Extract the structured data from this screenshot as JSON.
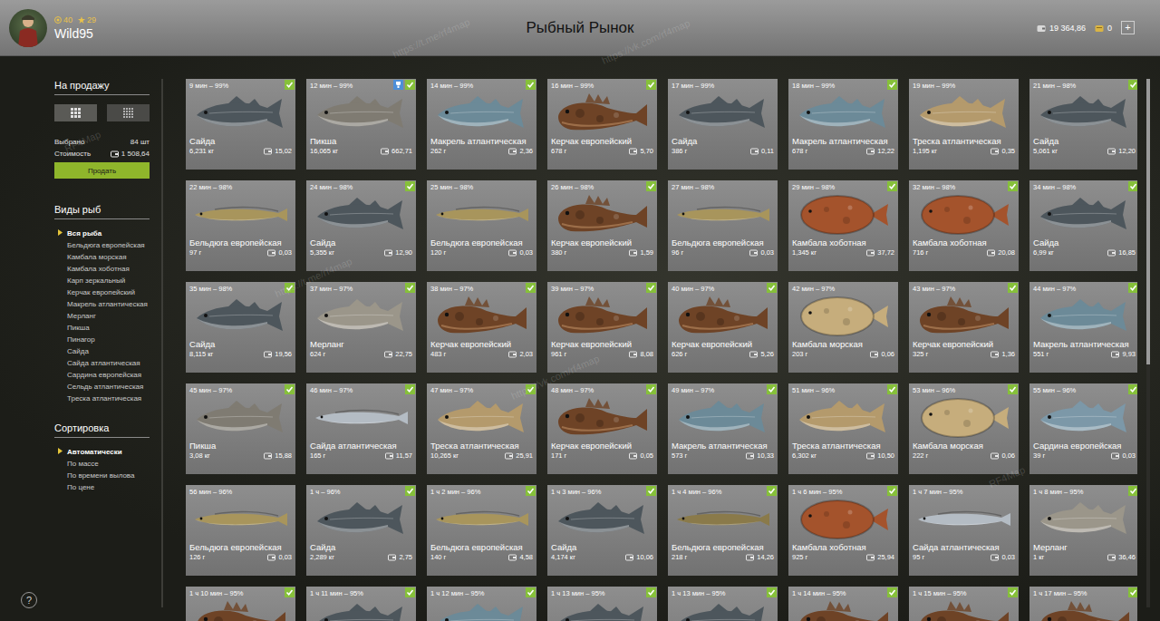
{
  "header": {
    "title": "Рыбный Рынок",
    "player": {
      "name": "Wild95",
      "level": "40",
      "stars": "29"
    },
    "money": "19 364,86",
    "gold": "0",
    "add": "+"
  },
  "sidebar": {
    "for_sale": "На продажу",
    "views": [
      {
        "selected": true
      },
      {
        "selected": false
      }
    ],
    "selected_label": "Выбрано",
    "selected_value": "84 шт",
    "cost_label": "Стоимость",
    "cost_value": "1 508,64",
    "sell": "Продать",
    "species_title": "Виды рыб",
    "species": [
      {
        "label": "Вся рыба",
        "selected": true
      },
      {
        "label": "Бельдюга европейская",
        "selected": false
      },
      {
        "label": "Камбала морская",
        "selected": false
      },
      {
        "label": "Камбала хоботная",
        "selected": false
      },
      {
        "label": "Карп зеркальный",
        "selected": false
      },
      {
        "label": "Керчак европейский",
        "selected": false
      },
      {
        "label": "Макрель атлантическая",
        "selected": false
      },
      {
        "label": "Мерланг",
        "selected": false
      },
      {
        "label": "Пикша",
        "selected": false
      },
      {
        "label": "Пинагор",
        "selected": false
      },
      {
        "label": "Сайда",
        "selected": false
      },
      {
        "label": "Сайда атлантическая",
        "selected": false
      },
      {
        "label": "Сардина европейская",
        "selected": false
      },
      {
        "label": "Сельдь атлантическая",
        "selected": false
      },
      {
        "label": "Треска атлантическая",
        "selected": false
      }
    ],
    "sort_title": "Сортировка",
    "sort": [
      {
        "label": "Автоматически",
        "selected": true
      },
      {
        "label": "По массе",
        "selected": false
      },
      {
        "label": "По времени вылова",
        "selected": false
      },
      {
        "label": "По цене",
        "selected": false
      }
    ]
  },
  "help": "?",
  "scrollbar": {
    "level": 0.54
  },
  "cards": [
    {
      "time": "9 мин – 99%",
      "name": "Сайда",
      "weight": "6,231 кг",
      "price": "15,02",
      "selected": true,
      "badge": false,
      "kind": "round",
      "color": "#4d565c"
    },
    {
      "time": "12 мин – 99%",
      "name": "Пикша",
      "weight": "16,065 кг",
      "price": "662,71",
      "selected": true,
      "badge": true,
      "kind": "round",
      "color": "#7f7b72"
    },
    {
      "time": "14 мин – 99%",
      "name": "Макрель атлантическая",
      "weight": "262 г",
      "price": "2,36",
      "selected": true,
      "badge": false,
      "kind": "round",
      "color": "#6c8a98"
    },
    {
      "time": "16 мин – 99%",
      "name": "Керчак европейский",
      "weight": "678 г",
      "price": "5,70",
      "selected": true,
      "badge": false,
      "kind": "spiny",
      "color": "#6e4326"
    },
    {
      "time": "17 мин – 99%",
      "name": "Сайда",
      "weight": "386 г",
      "price": "0,11",
      "selected": false,
      "badge": false,
      "kind": "round",
      "color": "#4d565c"
    },
    {
      "time": "18 мин – 99%",
      "name": "Макрель атлантическая",
      "weight": "678 г",
      "price": "12,22",
      "selected": true,
      "badge": false,
      "kind": "round",
      "color": "#6c8a98"
    },
    {
      "time": "19 мин – 99%",
      "name": "Треска атлантическая",
      "weight": "1,195 кг",
      "price": "0,35",
      "selected": false,
      "badge": false,
      "kind": "round",
      "color": "#b49a6c"
    },
    {
      "time": "21 мин – 98%",
      "name": "Сайда",
      "weight": "5,061 кг",
      "price": "12,20",
      "selected": true,
      "badge": false,
      "kind": "round",
      "color": "#4d565c"
    },
    {
      "time": "22 мин – 98%",
      "name": "Бельдюга европейская",
      "weight": "97 г",
      "price": "0,03",
      "selected": false,
      "badge": false,
      "kind": "long",
      "color": "#a8955c"
    },
    {
      "time": "24 мин – 98%",
      "name": "Сайда",
      "weight": "5,355 кг",
      "price": "12,90",
      "selected": true,
      "badge": false,
      "kind": "round",
      "color": "#4d565c"
    },
    {
      "time": "25 мин – 98%",
      "name": "Бельдюга европейская",
      "weight": "120 г",
      "price": "0,03",
      "selected": false,
      "badge": false,
      "kind": "long",
      "color": "#a8955c"
    },
    {
      "time": "26 мин – 98%",
      "name": "Керчак европейский",
      "weight": "380 г",
      "price": "1,59",
      "selected": true,
      "badge": false,
      "kind": "spiny",
      "color": "#6e4326"
    },
    {
      "time": "27 мин – 98%",
      "name": "Бельдюга европейская",
      "weight": "96 г",
      "price": "0,03",
      "selected": false,
      "badge": false,
      "kind": "long",
      "color": "#a8955c"
    },
    {
      "time": "29 мин – 98%",
      "name": "Камбала хоботная",
      "weight": "1,345 кг",
      "price": "37,72",
      "selected": true,
      "badge": false,
      "kind": "flat",
      "color": "#a4532c"
    },
    {
      "time": "32 мин – 98%",
      "name": "Камбала хоботная",
      "weight": "716 г",
      "price": "20,08",
      "selected": true,
      "badge": false,
      "kind": "flat",
      "color": "#a4532c"
    },
    {
      "time": "34 мин – 98%",
      "name": "Сайда",
      "weight": "6,99 кг",
      "price": "16,85",
      "selected": true,
      "badge": false,
      "kind": "round",
      "color": "#4d565c"
    },
    {
      "time": "35 мин – 98%",
      "name": "Сайда",
      "weight": "8,115 кг",
      "price": "19,56",
      "selected": true,
      "badge": false,
      "kind": "round",
      "color": "#4d565c"
    },
    {
      "time": "37 мин – 97%",
      "name": "Мерланг",
      "weight": "624 г",
      "price": "22,75",
      "selected": true,
      "badge": false,
      "kind": "round",
      "color": "#9b968a"
    },
    {
      "time": "38 мин – 97%",
      "name": "Керчак европейский",
      "weight": "483 г",
      "price": "2,03",
      "selected": true,
      "badge": false,
      "kind": "spiny",
      "color": "#6e4326"
    },
    {
      "time": "39 мин – 97%",
      "name": "Керчак европейский",
      "weight": "961 г",
      "price": "8,08",
      "selected": true,
      "badge": false,
      "kind": "spiny",
      "color": "#6e4326"
    },
    {
      "time": "40 мин – 97%",
      "name": "Керчак европейский",
      "weight": "626 г",
      "price": "5,26",
      "selected": true,
      "badge": false,
      "kind": "spiny",
      "color": "#6e4326"
    },
    {
      "time": "42 мин – 97%",
      "name": "Камбала морская",
      "weight": "203 г",
      "price": "0,06",
      "selected": false,
      "badge": false,
      "kind": "flat",
      "color": "#c6ad7c"
    },
    {
      "time": "43 мин – 97%",
      "name": "Керчак европейский",
      "weight": "325 г",
      "price": "1,36",
      "selected": true,
      "badge": false,
      "kind": "spiny",
      "color": "#6e4326"
    },
    {
      "time": "44 мин – 97%",
      "name": "Макрель атлантическая",
      "weight": "551 г",
      "price": "9,93",
      "selected": true,
      "badge": false,
      "kind": "round",
      "color": "#6c8a98"
    },
    {
      "time": "45 мин – 97%",
      "name": "Пикша",
      "weight": "3,08 кг",
      "price": "15,88",
      "selected": true,
      "badge": false,
      "kind": "round",
      "color": "#7f7b72"
    },
    {
      "time": "46 мин – 97%",
      "name": "Сайда атлантическая",
      "weight": "165 г",
      "price": "11,57",
      "selected": true,
      "badge": false,
      "kind": "long",
      "color": "#b4bcc4"
    },
    {
      "time": "47 мин – 97%",
      "name": "Треска атлантическая",
      "weight": "10,265 кг",
      "price": "25,91",
      "selected": true,
      "badge": false,
      "kind": "round",
      "color": "#b49a6c"
    },
    {
      "time": "48 мин – 97%",
      "name": "Керчак европейский",
      "weight": "171 г",
      "price": "0,05",
      "selected": true,
      "badge": false,
      "kind": "spiny",
      "color": "#6e4326"
    },
    {
      "time": "49 мин – 97%",
      "name": "Макрель атлантическая",
      "weight": "573 г",
      "price": "10,33",
      "selected": true,
      "badge": false,
      "kind": "round",
      "color": "#6c8a98"
    },
    {
      "time": "51 мин – 96%",
      "name": "Треска атлантическая",
      "weight": "6,302 кг",
      "price": "10,50",
      "selected": true,
      "badge": false,
      "kind": "round",
      "color": "#b49a6c"
    },
    {
      "time": "53 мин – 96%",
      "name": "Камбала морская",
      "weight": "222 г",
      "price": "0,06",
      "selected": true,
      "badge": false,
      "kind": "flat",
      "color": "#c6ad7c"
    },
    {
      "time": "55 мин – 96%",
      "name": "Сардина европейская",
      "weight": "39 г",
      "price": "0,03",
      "selected": true,
      "badge": false,
      "kind": "round",
      "color": "#7c98a8"
    },
    {
      "time": "56 мин – 96%",
      "name": "Бельдюга европейская",
      "weight": "126 г",
      "price": "0,03",
      "selected": false,
      "badge": false,
      "kind": "long",
      "color": "#a8955c"
    },
    {
      "time": "1 ч – 96%",
      "name": "Сайда",
      "weight": "2,289 кг",
      "price": "2,75",
      "selected": true,
      "badge": false,
      "kind": "round",
      "color": "#4d565c"
    },
    {
      "time": "1 ч 2 мин – 96%",
      "name": "Бельдюга европейская",
      "weight": "140 г",
      "price": "4,58",
      "selected": true,
      "badge": false,
      "kind": "long",
      "color": "#a8955c"
    },
    {
      "time": "1 ч 3 мин – 96%",
      "name": "Сайда",
      "weight": "4,174 кг",
      "price": "10,06",
      "selected": true,
      "badge": false,
      "kind": "round",
      "color": "#4d565c"
    },
    {
      "time": "1 ч 4 мин – 96%",
      "name": "Бельдюга европейская",
      "weight": "218 г",
      "price": "14,26",
      "selected": true,
      "badge": false,
      "kind": "long",
      "color": "#8a7a4a"
    },
    {
      "time": "1 ч 6 мин – 95%",
      "name": "Камбала хоботная",
      "weight": "925 г",
      "price": "25,94",
      "selected": true,
      "badge": false,
      "kind": "flat",
      "color": "#a4532c"
    },
    {
      "time": "1 ч 7 мин – 95%",
      "name": "Сайда атлантическая",
      "weight": "95 г",
      "price": "0,03",
      "selected": false,
      "badge": false,
      "kind": "long",
      "color": "#b4bcc4"
    },
    {
      "time": "1 ч 8 мин – 95%",
      "name": "Мерланг",
      "weight": "1 кг",
      "price": "36,46",
      "selected": true,
      "badge": false,
      "kind": "round",
      "color": "#9b968a"
    },
    {
      "time": "1 ч 10 мин – 95%",
      "selected": true,
      "badge": false,
      "kind": "spiny",
      "color": "#6e4326"
    },
    {
      "time": "1 ч 11 мин – 95%",
      "selected": true,
      "badge": false,
      "kind": "round",
      "color": "#4d565c"
    },
    {
      "time": "1 ч 12 мин – 95%",
      "selected": true,
      "badge": false,
      "kind": "round",
      "color": "#6c8a98"
    },
    {
      "time": "1 ч 13 мин – 95%",
      "selected": true,
      "badge": false,
      "kind": "round",
      "color": "#4d565c"
    },
    {
      "time": "1 ч 13 мин – 95%",
      "selected": true,
      "badge": false,
      "kind": "round",
      "color": "#4d565c"
    },
    {
      "time": "1 ч 14 мин – 95%",
      "selected": true,
      "badge": false,
      "kind": "spiny",
      "color": "#6e4326"
    },
    {
      "time": "1 ч 15 мин – 95%",
      "selected": true,
      "badge": false,
      "kind": "spiny",
      "color": "#6e4326"
    },
    {
      "time": "1 ч 17 мин – 95%",
      "selected": true,
      "badge": false,
      "kind": "spiny",
      "color": "#6e4326"
    }
  ],
  "watermarks": [
    "https://t.me/rf4map",
    "https://vk.com/rf4map",
    "RF4Map",
    "https://t.me/rf4map",
    "https://vk.com/rf4map",
    "RF4Map"
  ]
}
